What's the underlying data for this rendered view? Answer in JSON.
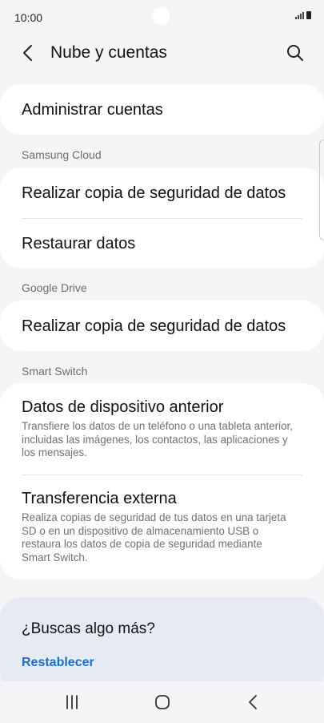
{
  "status_bar": {
    "time": "10:00"
  },
  "app_bar": {
    "title": "Nube y cuentas",
    "back_icon": "chevron-left-icon",
    "search_icon": "search-icon"
  },
  "accounts": {
    "manage_label": "Administrar cuentas"
  },
  "samsung_cloud": {
    "header": "Samsung Cloud",
    "backup_label": "Realizar copia de seguridad de datos",
    "restore_label": "Restaurar datos"
  },
  "google_drive": {
    "header": "Google Drive",
    "backup_label": "Realizar copia de seguridad de datos"
  },
  "smart_switch": {
    "header": "Smart Switch",
    "previous_device_title": "Datos de dispositivo anterior",
    "previous_device_desc": "Transfiere los datos de un teléfono o una tableta anterior, incluidas las imágenes, los contactos, las aplicaciones y los mensajes.",
    "external_transfer_title": "Transferencia externa",
    "external_transfer_desc": "Realiza copias de seguridad de tus datos en una tarjeta SD o en un dispositivo de almacenamiento USB o restaura los datos de copia de seguridad mediante Smart Switch."
  },
  "looking_for_more": {
    "title": "¿Buscas algo más?",
    "reset_link": "Restablecer"
  },
  "colors": {
    "background": "#f5f5f7",
    "card": "#ffffff",
    "link": "#1c6fc7",
    "more_card": "#e6eaf2"
  }
}
